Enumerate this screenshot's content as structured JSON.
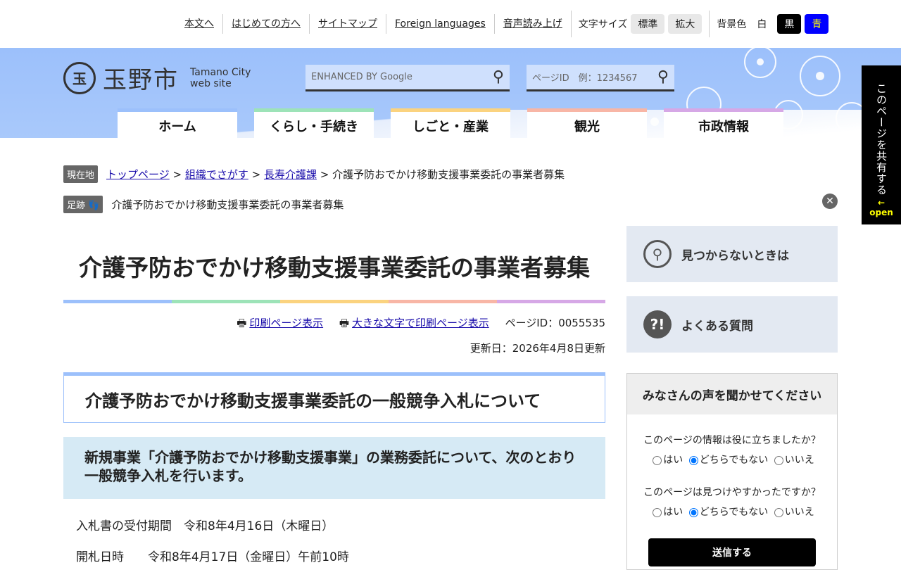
{
  "utility": {
    "links": [
      "本文へ",
      "はじめての方へ",
      "サイトマップ",
      "Foreign languages",
      "音声読み上げ"
    ],
    "font_size_label": "文字サイズ",
    "font_standard": "標準",
    "font_large": "拡大",
    "bg_label": "背景色",
    "bg_white": "白",
    "bg_black": "黒",
    "bg_blue": "青"
  },
  "header": {
    "seal": "玉",
    "logo": "玉野市",
    "sub1": "Tamano City",
    "sub2": "web site",
    "google_placeholder": "ENHANCED BY Google",
    "pageid_placeholder": "ページID　例：1234567"
  },
  "nav": [
    {
      "label": "ホーム",
      "color": "#9cc0fb"
    },
    {
      "label": "くらし・手続き",
      "color": "#9de3b8"
    },
    {
      "label": "しごと・産業",
      "color": "#fbd37f"
    },
    {
      "label": "観光",
      "color": "#f8b6a6"
    },
    {
      "label": "市政情報",
      "color": "#d6a8e6"
    }
  ],
  "side_tab": {
    "text": "このページを共有する",
    "open": "open"
  },
  "breadcrumb": {
    "label": "現在地",
    "links": [
      "トップページ",
      "組織でさがす",
      "長寿介護課"
    ],
    "current": "介護予防おでかけ移動支援事業委託の事業者募集"
  },
  "footprint": {
    "label": "足跡",
    "item": "介護予防おでかけ移動支援事業委託の事業者募集"
  },
  "page": {
    "title": "介護予防おでかけ移動支援事業委託の事業者募集",
    "print": "印刷ページ表示",
    "print_large": "大きな文字で印刷ページ表示",
    "page_id": "ページID：0055535",
    "updated": "更新日：2026年4月8日更新",
    "h2": "介護予防おでかけ移動支援事業委託の一般競争入札について",
    "h3": "新規事業「介護予防おでかけ移動支援事業」の業務委託について、次のとおり一般競争入札を行います。",
    "p1": "入札書の受付期間　令和8年4月16日（木曜日）",
    "p2": "開札日時　　令和8年4月17日（金曜日）午前10時"
  },
  "sidebar": {
    "not_found": "見つからないときは",
    "faq": "よくある質問"
  },
  "survey": {
    "title": "みなさんの声を聞かせてください",
    "q1": "このページの情報は役に立ちましたか？",
    "q2": "このページは見つけやすかったですか？",
    "yes": "はい",
    "neutral": "どちらでもない",
    "no": "いいえ",
    "submit": "送信する"
  }
}
